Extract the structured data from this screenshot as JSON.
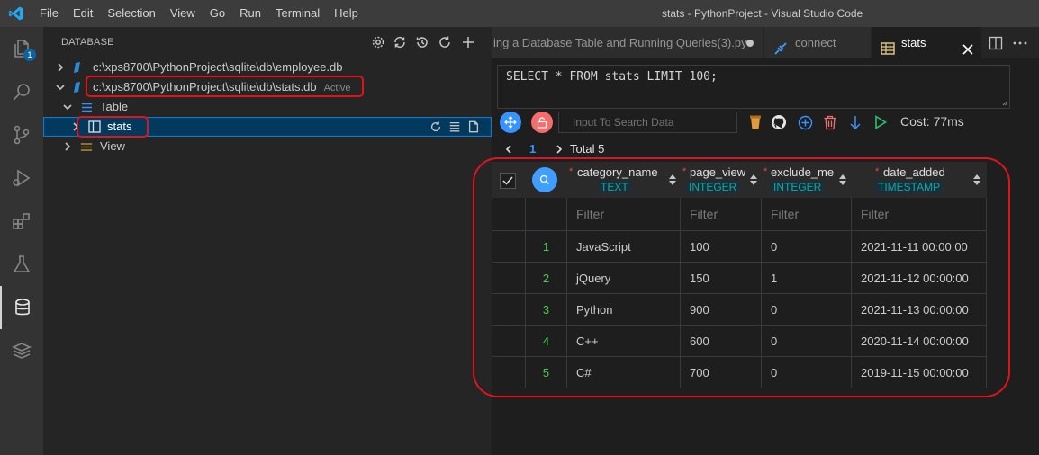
{
  "titlebar": {
    "menu": [
      "File",
      "Edit",
      "Selection",
      "View",
      "Go",
      "Run",
      "Terminal",
      "Help"
    ],
    "window_title": "stats - PythonProject - Visual Studio Code"
  },
  "activity": {
    "badge": "1"
  },
  "sidebar": {
    "title": "DATABASE",
    "connections": [
      {
        "label": "c:\\xps8700\\PythonProject\\sqlite\\db\\employee.db"
      },
      {
        "label": "c:\\xps8700\\PythonProject\\sqlite\\db\\stats.db",
        "status": "Active"
      }
    ],
    "table_group": "Table",
    "table_item": "stats",
    "view_group": "View"
  },
  "tabs": [
    {
      "label": "ing a Database Table and Running Queries(3).py"
    },
    {
      "label": "connect"
    },
    {
      "label": "stats"
    }
  ],
  "editor": {
    "query": "SELECT * FROM stats LIMIT 100;",
    "search_placeholder": "Input To Search Data",
    "cost": "Cost: 77ms",
    "page": "1",
    "total": "Total 5",
    "columns": [
      {
        "name": "category_name",
        "type": "TEXT"
      },
      {
        "name": "page_view",
        "type": "INTEGER"
      },
      {
        "name": "exclude_me",
        "type": "INTEGER"
      },
      {
        "name": "date_added",
        "type": "TIMESTAMP"
      }
    ],
    "filter_placeholder": "Filter",
    "rows": [
      {
        "n": "1",
        "category_name": "JavaScript",
        "page_view": "100",
        "exclude_me": "0",
        "date_added": "2021-11-11 00:00:00"
      },
      {
        "n": "2",
        "category_name": "jQuery",
        "page_view": "150",
        "exclude_me": "1",
        "date_added": "2021-11-12 00:00:00"
      },
      {
        "n": "3",
        "category_name": "Python",
        "page_view": "900",
        "exclude_me": "0",
        "date_added": "2021-11-13 00:00:00"
      },
      {
        "n": "4",
        "category_name": "C++",
        "page_view": "600",
        "exclude_me": "0",
        "date_added": "2020-11-14 00:00:00"
      },
      {
        "n": "5",
        "category_name": "C#",
        "page_view": "700",
        "exclude_me": "0",
        "date_added": "2019-11-15 00:00:00"
      }
    ]
  },
  "colors": {
    "accent": "#007fd4",
    "highlight": "#e0141b",
    "type_label": "#0fa7a7",
    "row_number": "#4ec94e"
  }
}
